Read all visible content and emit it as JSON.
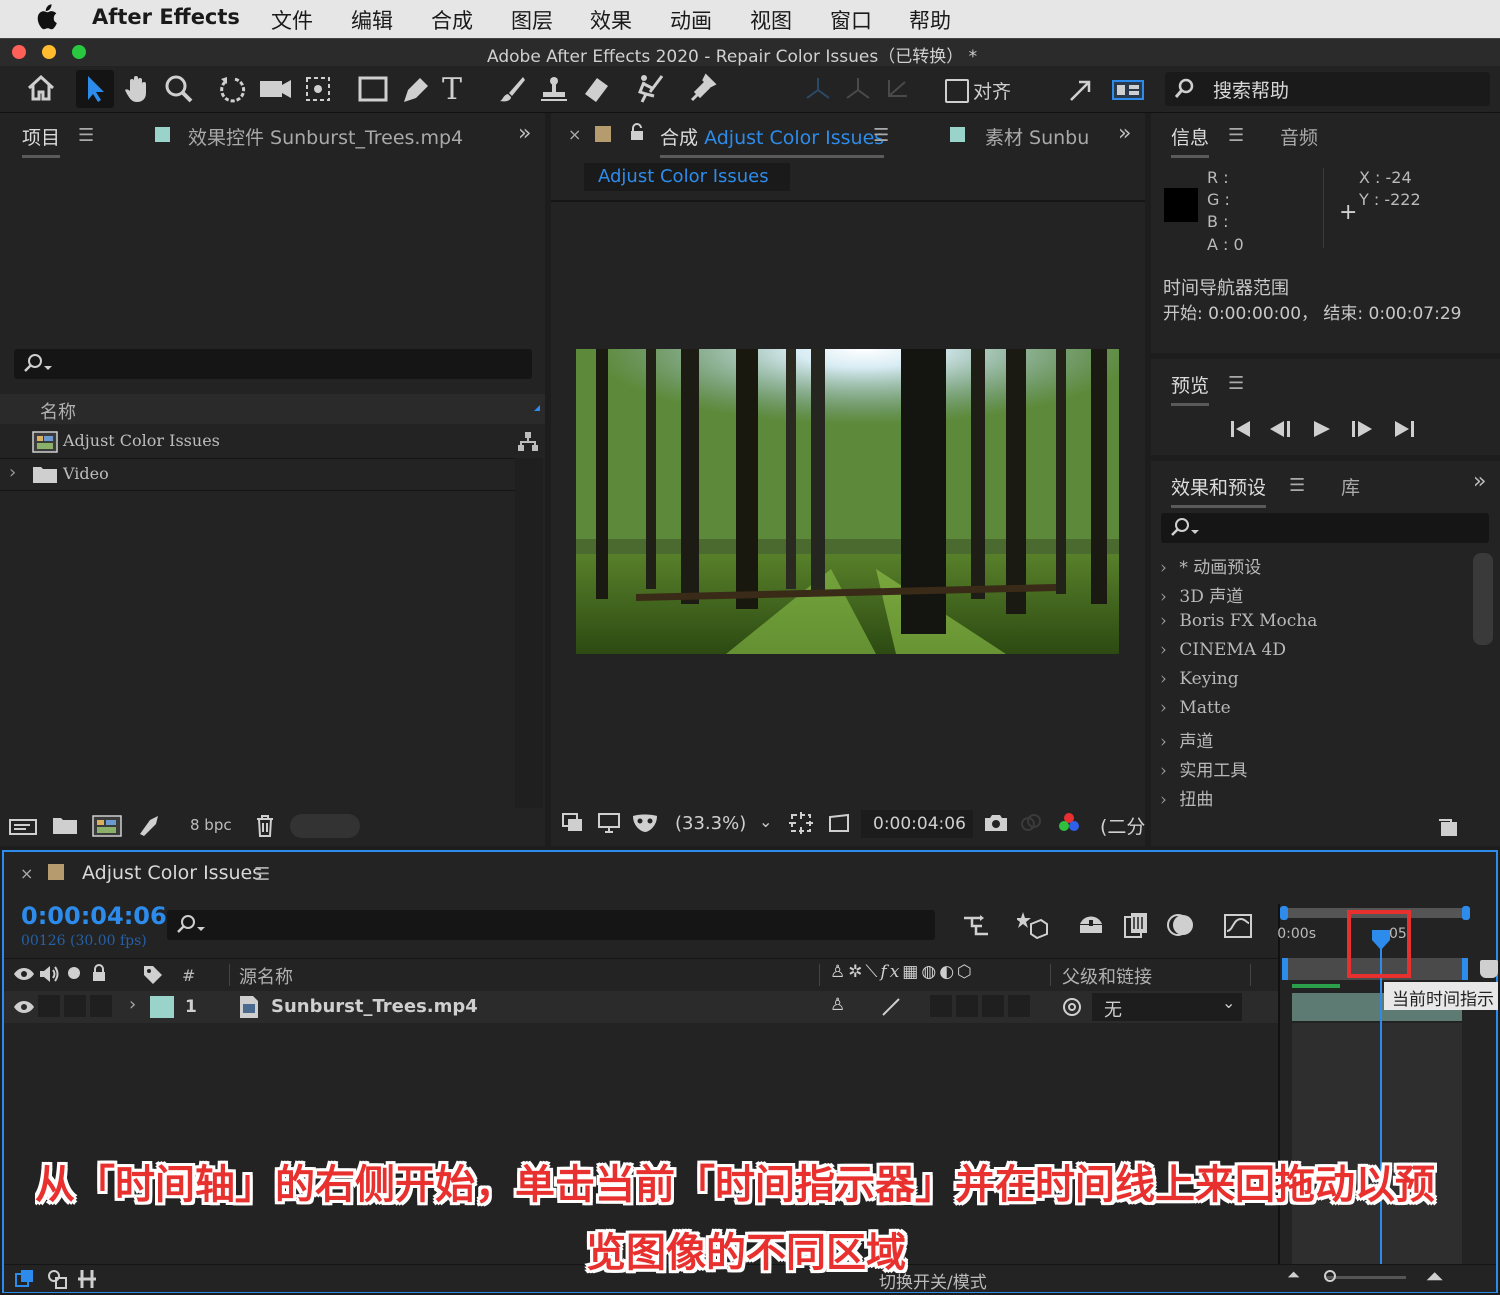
{
  "menubar": {
    "app": "After Effects",
    "items": [
      "文件",
      "编辑",
      "合成",
      "图层",
      "效果",
      "动画",
      "视图",
      "窗口",
      "帮助"
    ]
  },
  "window": {
    "title": "Adobe After Effects 2020 - Repair Color Issues（已转换） *"
  },
  "toolbar": {
    "align_label": "对齐",
    "search_help": "搜索帮助"
  },
  "project_panel": {
    "tab_project": "项目",
    "tab_effect_controls": "效果控件 Sunburst_Trees.mp4",
    "column_name": "名称",
    "items": [
      {
        "name": "Adjust Color Issues",
        "icon": "composition-icon"
      },
      {
        "name": "Video",
        "icon": "folder-icon"
      }
    ],
    "bpc": "8 bpc"
  },
  "composition_panel": {
    "tab_prefix": "合成",
    "tab_name": "Adjust Color Issues",
    "tab_footage": "素材 Sunbu",
    "breadcrumb": "Adjust Color Issues",
    "zoom": "(33.3%)",
    "timecode": "0:00:04:06",
    "resolution": "(二分"
  },
  "info_panel": {
    "tab_info": "信息",
    "tab_audio": "音频",
    "r_label": "R :",
    "g_label": "G :",
    "b_label": "B :",
    "a_label": "A :  0",
    "x_label": "X :  -24",
    "y_label": "Y :  -222",
    "nav_title": "时间导航器范围",
    "nav_range": "开始: 0:00:00:00，  结束: 0:00:07:29"
  },
  "preview_panel": {
    "title": "预览"
  },
  "effects_panel": {
    "tab_effects": "效果和预设",
    "tab_library": "库",
    "items": [
      "* 动画预设",
      "3D 声道",
      "Boris FX Mocha",
      "CINEMA 4D",
      "Keying",
      "Matte",
      "声道",
      "实用工具",
      "扭曲"
    ]
  },
  "timeline": {
    "comp_name": "Adjust Color Issues",
    "current_time": "0:00:04:06",
    "frame_info": "00126 (30.00 fps)",
    "col_hash": "#",
    "col_source": "源名称",
    "col_parent": "父级和链接",
    "layer_number": "1",
    "layer_name": "Sunburst_Trees.mp4",
    "parent_value": "无",
    "ruler_start": "0:00s",
    "ruler_mark": "05s",
    "tooltip": "当前时间指示",
    "toggle_modes": "切换开关/模式"
  },
  "caption": {
    "line1": "从「时间轴」的右侧开始，单击当前「时间指示器」并在时间线上来回拖动以预",
    "line2": "览图像的不同区域"
  },
  "colors": {
    "accent_blue": "#2d8ceb",
    "highlight_red": "#e8312f",
    "layer_label_teal": "#9ad3c9",
    "comp_label_tan": "#b59b6e"
  }
}
